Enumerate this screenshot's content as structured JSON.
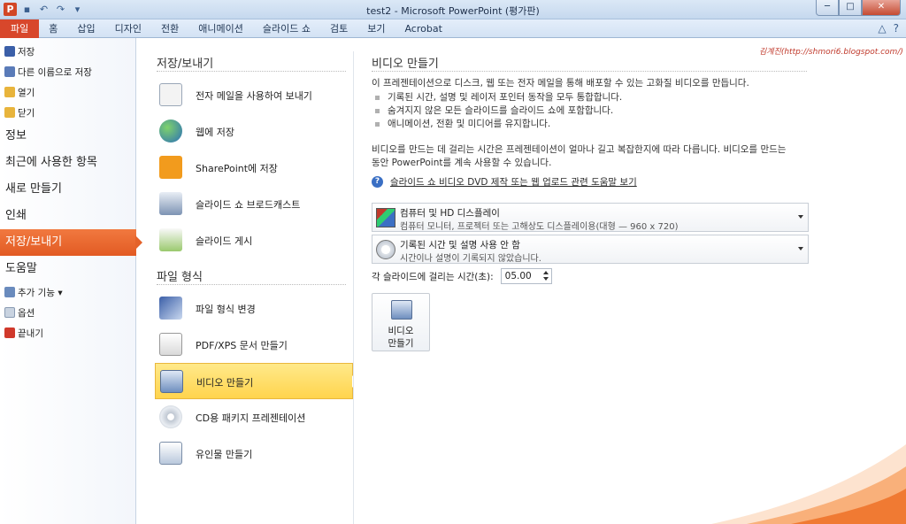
{
  "window": {
    "title": "test2 - Microsoft PowerPoint (평가판)",
    "app_icon_letter": "P",
    "controls": {
      "minimize": "─",
      "maximize": "□",
      "close": "✕"
    }
  },
  "ribbon": {
    "tabs": [
      "파일",
      "홈",
      "삽입",
      "디자인",
      "전환",
      "애니메이션",
      "슬라이드 쇼",
      "검토",
      "보기",
      "Acrobat"
    ],
    "right_icons": {
      "minimize_ribbon": "△",
      "help": "?"
    }
  },
  "leftnav": {
    "small_items": [
      {
        "label": "저장"
      },
      {
        "label": "다른 이름으로 저장"
      },
      {
        "label": "열기"
      },
      {
        "label": "닫기"
      }
    ],
    "big_items": [
      {
        "label": "정보"
      },
      {
        "label": "최근에 사용한 항목"
      },
      {
        "label": "새로 만들기"
      },
      {
        "label": "인쇄"
      },
      {
        "label": "저장/보내기"
      },
      {
        "label": "도움말"
      }
    ],
    "bottom_items": [
      {
        "label": "추가 기능 ▾"
      },
      {
        "label": "옵션"
      },
      {
        "label": "끝내기"
      }
    ]
  },
  "middle": {
    "section1_title": "저장/보내기",
    "section1_items": [
      {
        "label": "전자 메일을 사용하여 보내기"
      },
      {
        "label": "웹에 저장"
      },
      {
        "label": "SharePoint에 저장"
      },
      {
        "label": "슬라이드 쇼 브로드캐스트"
      },
      {
        "label": "슬라이드 게시"
      }
    ],
    "section2_title": "파일 형식",
    "section2_items": [
      {
        "label": "파일 형식 변경"
      },
      {
        "label": "PDF/XPS 문서 만들기"
      },
      {
        "label": "비디오 만들기"
      },
      {
        "label": "CD용 패키지 프레젠테이션"
      },
      {
        "label": "유인물 만들기"
      }
    ]
  },
  "right": {
    "credit": "김계진(http://shmori6.blogspot.com/)",
    "title": "비디오 만들기",
    "intro": "이 프레젠테이션으로 디스크, 웹 또는 전자 메일을 통해 배포할 수 있는 고화질 비디오를 만듭니다.",
    "bullets": [
      "기록된 시간, 설명 및 레이저 포인터 동작을 모두 통합합니다.",
      "숨겨지지 않은 모든 슬라이드를 슬라이드 쇼에 포함합니다.",
      "애니메이션, 전환 및 미디어를 유지합니다."
    ],
    "para2": "비디오를 만드는 데 걸리는 시간은 프레젠테이션이 얼마나 길고 복잡한지에 따라 다릅니다. 비디오를 만드는 동안 PowerPoint를 계속 사용할 수 있습니다.",
    "help_link": "슬라이드 쇼 비디오 DVD 제작 또는 웹 업로드 관련 도움말 보기",
    "dropdown1": {
      "title": "컴퓨터 및 HD 디스플레이",
      "subtitle": "컴퓨터 모니터, 프로젝터 또는 고해상도 디스플레이용(대형 — 960 x 720)"
    },
    "dropdown2": {
      "title": "기록된 시간 및 설명 사용 안 함",
      "subtitle": "시간이나 설명이 기록되지 않았습니다."
    },
    "duration_label": "각 슬라이드에 걸리는 시간(초):",
    "duration_value": "05.00",
    "create_button": {
      "line1": "비디오",
      "line2": "만들기"
    }
  },
  "colors": {
    "file_tab": "#d8472b",
    "active_nav": "#e4622a",
    "selected_item": "#ffd44d"
  }
}
